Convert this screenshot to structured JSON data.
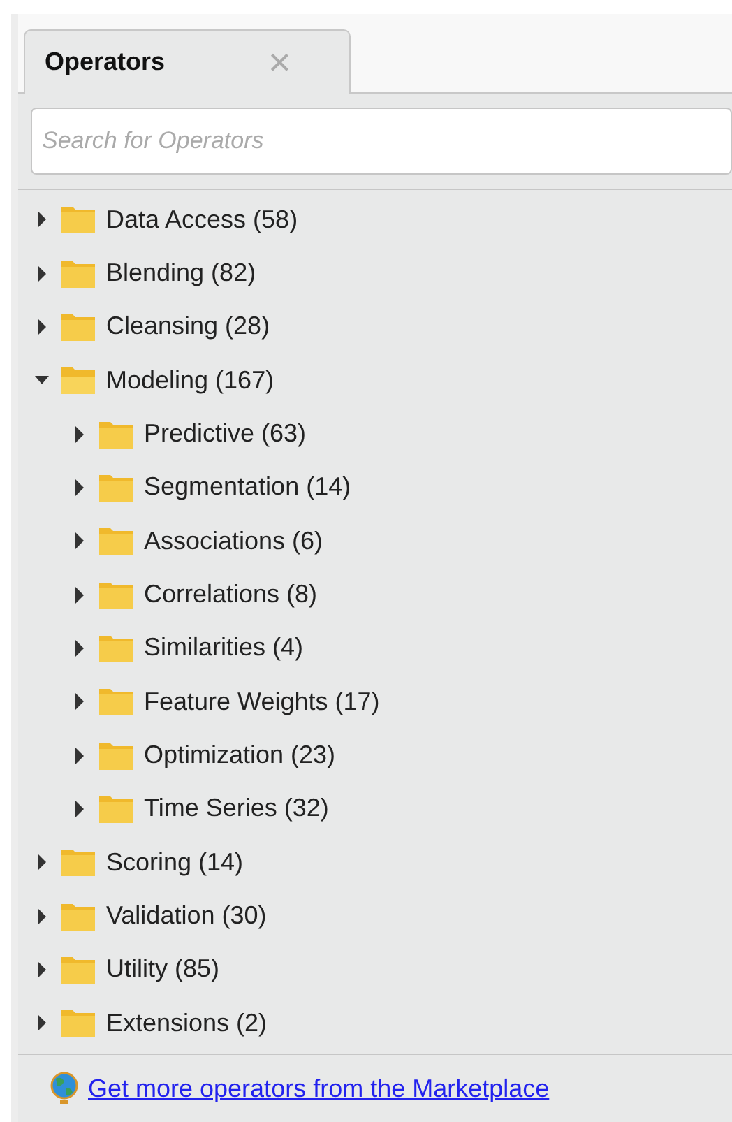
{
  "tabs": [
    {
      "label": "Operators",
      "selected": true,
      "close": "×"
    }
  ],
  "search": {
    "placeholder": "Search for Operators"
  },
  "tree": [
    {
      "label": "Data Access (58)",
      "expanded": false
    },
    {
      "label": "Blending (82)",
      "expanded": false
    },
    {
      "label": "Cleansing (28)",
      "expanded": false
    },
    {
      "label": "Modeling (167)",
      "expanded": true,
      "children": [
        {
          "label": "Predictive (63)",
          "expanded": false
        },
        {
          "label": "Segmentation (14)",
          "expanded": false
        },
        {
          "label": "Associations (6)",
          "expanded": false
        },
        {
          "label": "Correlations (8)",
          "expanded": false
        },
        {
          "label": "Similarities (4)",
          "expanded": false
        },
        {
          "label": "Feature Weights (17)",
          "expanded": false
        },
        {
          "label": "Optimization (23)",
          "expanded": false
        },
        {
          "label": "Time Series (32)",
          "expanded": false
        }
      ]
    },
    {
      "label": "Scoring (14)",
      "expanded": false
    },
    {
      "label": "Validation (30)",
      "expanded": false
    },
    {
      "label": "Utility (85)",
      "expanded": false
    },
    {
      "label": "Extensions (2)",
      "expanded": false
    }
  ],
  "footer": {
    "link": "Get more operators from the Marketplace"
  }
}
